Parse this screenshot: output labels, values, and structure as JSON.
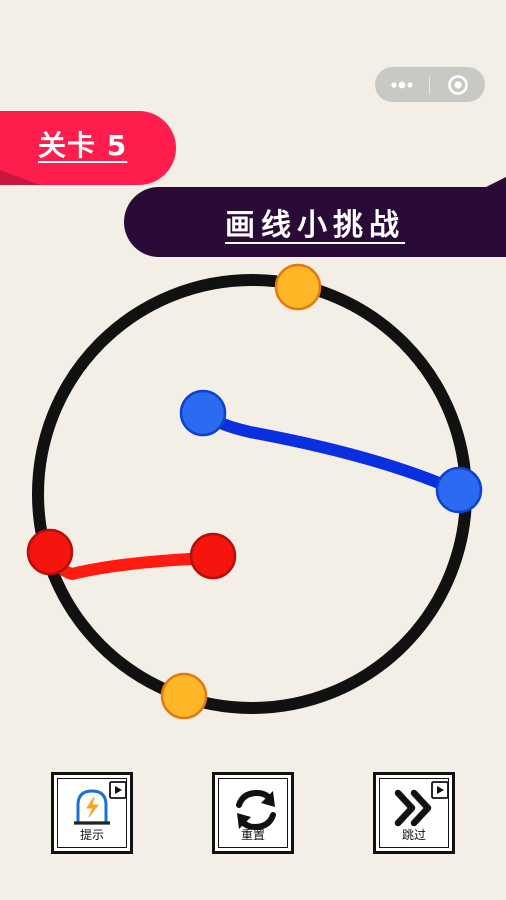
{
  "level": {
    "label": "关卡 5"
  },
  "title": "画线小挑战",
  "capsule": {
    "menu_icon": "more-dots-icon",
    "close_icon": "target-circle-icon"
  },
  "board": {
    "ring_color": "#111111",
    "pairs": [
      {
        "color": "orange",
        "fill": "#ffb627",
        "stroke": "#e07b12"
      },
      {
        "color": "blue",
        "fill": "#2a6bf2",
        "stroke": "#0e42c9",
        "line": "#0a2fe0"
      },
      {
        "color": "red",
        "fill": "#f5140e",
        "stroke": "#b30f0b",
        "line": "#ff1a12"
      }
    ]
  },
  "buttons": {
    "hint": {
      "label": "提示",
      "icon": "lightning-bulb-icon",
      "badge_icon": "play-ad-icon"
    },
    "reset": {
      "label": "重置",
      "icon": "refresh-arrows-icon"
    },
    "skip": {
      "label": "跳过",
      "icon": "double-chevron-icon",
      "badge_icon": "play-ad-icon"
    }
  }
}
